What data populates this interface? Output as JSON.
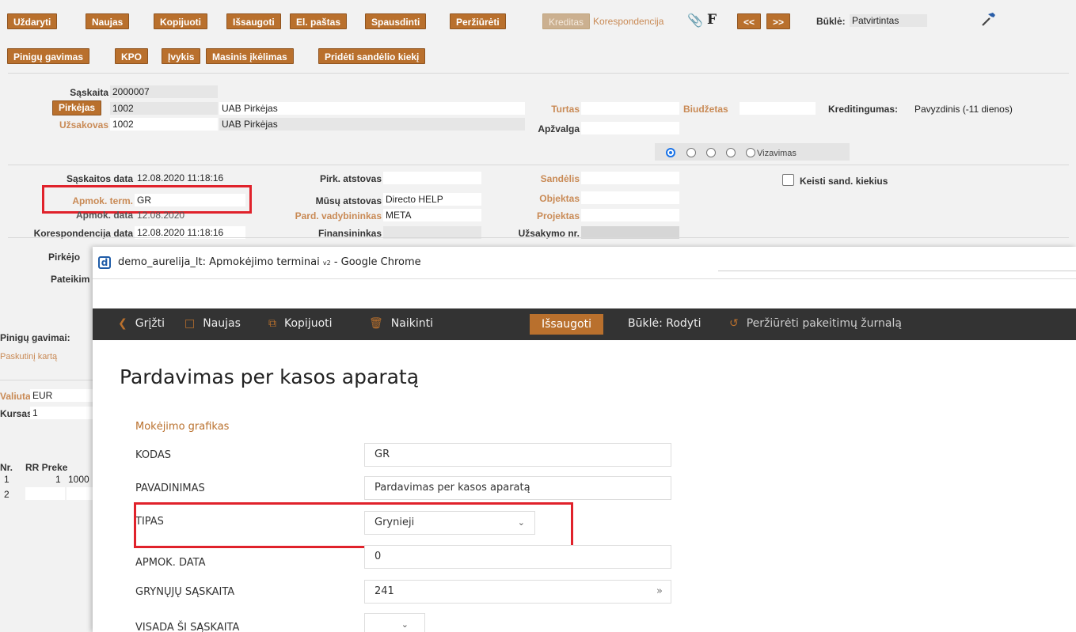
{
  "toolbar": {
    "row1": [
      "Uždaryti",
      "Naujas",
      "Kopijuoti",
      "Išsaugoti",
      "El. paštas",
      "Spausdinti",
      "Peržiūrėti"
    ],
    "kreditas": "Kreditas",
    "korespondencija": "Korespondencija",
    "f_label": "F",
    "prev": "<<",
    "next": ">>",
    "status_label": "Būklė:",
    "status_value": "Patvirtintas",
    "row2": [
      "Pinigų gavimas",
      "KPO",
      "Įvykis",
      "Masinis įkėlimas",
      "Pridėti sandėlio kiekį"
    ]
  },
  "header": {
    "saskaita_label": "Sąskaita",
    "saskaita": "2000007",
    "pirkejas_btn": "Pirkėjas",
    "pirkejas_code": "1002",
    "pirkejas_name": "UAB Pirkėjas",
    "uzsakovas_label": "Užsakovas",
    "uzsakovas_code": "1002",
    "uzsakovas_name": "UAB Pirkėjas",
    "turtas_label": "Turtas",
    "biudzetas_label": "Biudžetas",
    "kreditingumas_label": "Kreditingumas:",
    "kreditingumas_value": "Pavyzdinis (-11 dienos)",
    "apzvalga_label": "Apžvalga",
    "vizavimas": "Vizavimas"
  },
  "details": {
    "saskaitos_data_label": "Sąskaitos data",
    "saskaitos_data": "12.08.2020 11:18:16",
    "apmok_term_label": "Apmok. term.",
    "apmok_term": "GR",
    "apmok_data_label": "Apmok. data",
    "apmok_data": "12.08.2020",
    "koresp_data_label": "Korespondencija data",
    "koresp_data": "12.08.2020 11:18:16",
    "pirkejo_label": "Pirkėjo",
    "pateikim_label": "Pateikim",
    "pirk_atstovas_label": "Pirk. atstovas",
    "musu_atstovas_label": "Mūsų atstovas",
    "musu_atstovas": "Directo HELP",
    "pard_vad_label": "Pard. vadybininkas",
    "pard_vad": "META",
    "finansininkas_label": "Finansininkas",
    "sandelis_label": "Sandėlis",
    "objektas_label": "Objektas",
    "projektas_label": "Projektas",
    "uzsakymo_nr_label": "Užsakymo nr.",
    "keisti_label": "Keisti sand. kiekius",
    "pinigu_gavimai": "Pinigų gavimai:",
    "paskutini": "Paskutinį kartą",
    "valiuta_label": "Valiuta",
    "valiuta": "EUR",
    "kursas_label": "Kursas",
    "kursas": "1",
    "nr_head": "Nr.",
    "rr_head": "RR Preke",
    "row1_nr": "1",
    "row1_rr": "1",
    "row1_code": "1000",
    "row2_nr": "2"
  },
  "popup": {
    "window_title": "demo_aurelija_lt: Apmokėjimo terminai",
    "title_sub": "v2",
    "window_title_tail": "- Google Chrome",
    "toolbar": {
      "back": "Grįžti",
      "new": "Naujas",
      "copy": "Kopijuoti",
      "delete": "Naikinti",
      "save": "Išsaugoti",
      "status": "Būklė: Rodyti",
      "history": "Peržiūrėti pakeitimų žurnalą"
    },
    "page_title": "Pardavimas per kasos aparatą",
    "section": "Mokėjimo grafikas",
    "fields": {
      "kodas_label": "KODAS",
      "kodas": "GR",
      "pavadinimas_label": "PAVADINIMAS",
      "pavadinimas": "Pardavimas per kasos aparatą",
      "tipas_label": "TIPAS",
      "tipas": "Grynieji",
      "apmok_data_label": "APMOK. DATA",
      "apmok_data": "0",
      "grynuju_label": "GRYNŲJŲ SĄSKAITA",
      "grynuju": "241",
      "visada_label": "VISADA ŠI SĄSKAITA"
    }
  },
  "colors": {
    "accent": "#b9702d",
    "highlight": "#e0222b",
    "toolbar_bg": "#333333"
  }
}
